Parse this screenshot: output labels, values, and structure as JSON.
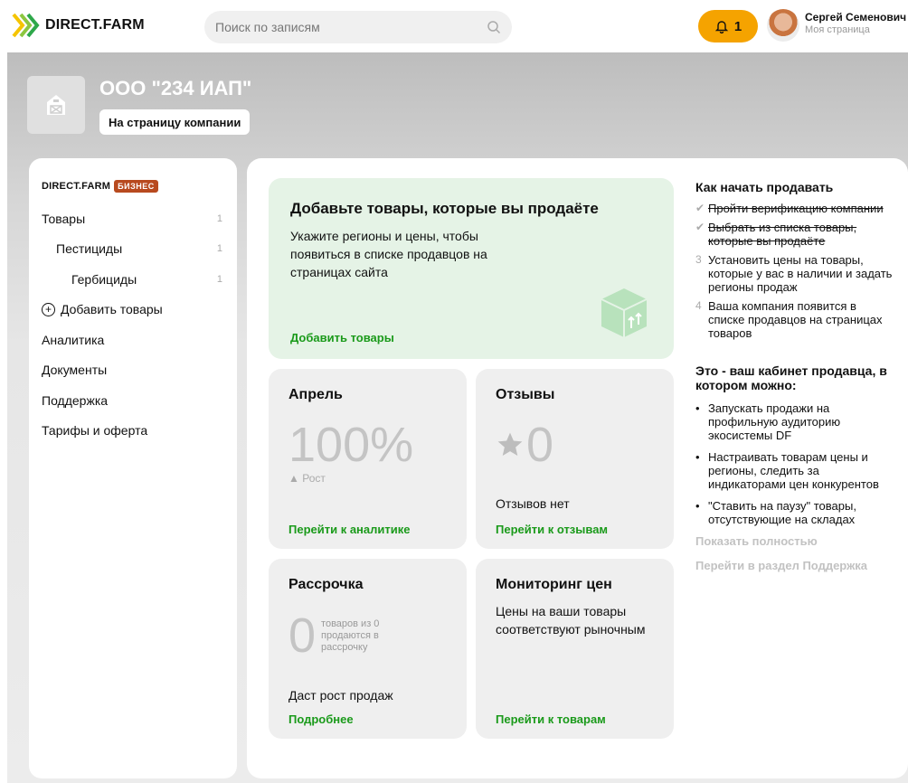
{
  "header": {
    "logo_text": "DIRECT.FARM",
    "search_placeholder": "Поиск по записям",
    "notifications_count": "1",
    "user_name": "Сергей Семенович",
    "user_sub": "Моя страница"
  },
  "company": {
    "name": "ООО \"234 ИАП\"",
    "link_label": "На страницу компании"
  },
  "sidebar": {
    "brand": "DIRECT.FARM",
    "badge": "БИЗНЕС",
    "items": [
      {
        "label": "Товары",
        "count": "1"
      },
      {
        "label": "Пестициды",
        "count": "1"
      },
      {
        "label": "Гербициды",
        "count": "1"
      },
      {
        "label": "Добавить товары"
      },
      {
        "label": "Аналитика"
      },
      {
        "label": "Документы"
      },
      {
        "label": "Поддержка"
      },
      {
        "label": "Тарифы и оферта"
      }
    ]
  },
  "hero": {
    "title": "Добавьте товары, которые вы продаёте",
    "text": "Укажите регионы и цены, чтобы появиться в списке продавцов на страницах сайта",
    "link": "Добавить товары"
  },
  "april": {
    "title": "Апрель",
    "value": "100%",
    "growth": "▲ Рост",
    "link": "Перейти к аналитике"
  },
  "reviews": {
    "title": "Отзывы",
    "value": "0",
    "note": "Отзывов нет",
    "link": "Перейти к отзывам"
  },
  "installment": {
    "title": "Рассрочка",
    "value": "0",
    "text": "товаров из 0 продаются в рассрочку",
    "note": "Даст рост продаж",
    "link": "Подробнее"
  },
  "monitoring": {
    "title": "Мониторинг цен",
    "text": "Цены на ваши товары соответствуют рыночным",
    "link": "Перейти к товарам"
  },
  "howto": {
    "title": "Как начать продавать",
    "steps": [
      {
        "mark": "✔",
        "text": "Пройти верификацию компании"
      },
      {
        "mark": "✔",
        "text": "Выбрать из списка товары, которые вы продаёте"
      },
      {
        "mark": "3",
        "text": "Установить цены на товары, которые у вас в наличии и задать регионы продаж"
      },
      {
        "mark": "4",
        "text": "Ваша компания появится в списке продавцов на страницах товаров"
      }
    ],
    "title2": "Это - ваш кабинет продавца, в котором можно:",
    "bullets": [
      "Запускать продажи на профильную аудиторию экосистемы DF",
      "Настраивать товарам цены и регионы, следить за индикаторами цен конкурентов",
      "\"Ставить на паузу\" товары, отсутствующие на складах"
    ],
    "show_all": "Показать полностью",
    "support_link": "Перейти в раздел Поддержка"
  },
  "colors": {
    "accent_green": "#1a9a1a",
    "hero_bg": "#e5f3e6",
    "bell_orange": "#f5a300",
    "badge_brown": "#b84a1f"
  }
}
